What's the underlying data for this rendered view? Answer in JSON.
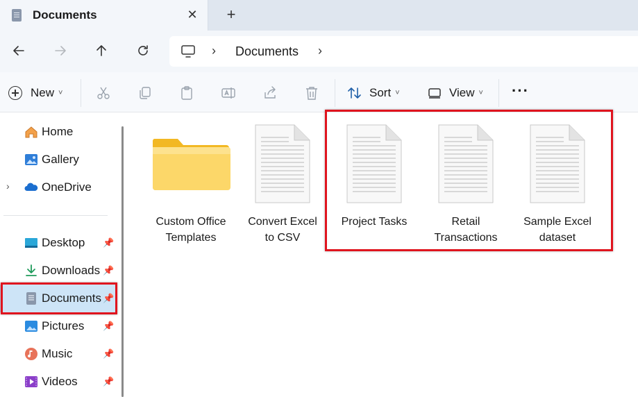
{
  "tab": {
    "title": "Documents",
    "close": "✕",
    "new": "+"
  },
  "address": {
    "path": "Documents",
    "sep": "›"
  },
  "toolbar": {
    "new_label": "New",
    "sort_label": "Sort",
    "view_label": "View",
    "more_label": "···",
    "caret": "˅"
  },
  "sidebar": {
    "items": [
      {
        "label": "Home",
        "icon": "home-icon"
      },
      {
        "label": "Gallery",
        "icon": "gallery-icon"
      },
      {
        "label": "OneDrive",
        "icon": "onedrive-icon",
        "expander": "›"
      },
      {
        "label": "Desktop",
        "icon": "desktop-icon",
        "pin": "📌"
      },
      {
        "label": "Downloads",
        "icon": "downloads-icon",
        "pin": "📌"
      },
      {
        "label": "Documents",
        "icon": "documents-icon",
        "pin": "📌",
        "active": true
      },
      {
        "label": "Pictures",
        "icon": "pictures-icon",
        "pin": "📌"
      },
      {
        "label": "Music",
        "icon": "music-icon",
        "pin": "📌"
      },
      {
        "label": "Videos",
        "icon": "videos-icon",
        "pin": "📌"
      }
    ]
  },
  "files": [
    {
      "line1": "Custom Office",
      "line2": "Templates",
      "type": "folder"
    },
    {
      "line1": "Convert Excel",
      "line2": "to CSV",
      "type": "document"
    },
    {
      "line1": "Project Tasks",
      "line2": "",
      "type": "document"
    },
    {
      "line1": "Retail",
      "line2": "Transactions",
      "type": "document"
    },
    {
      "line1": "Sample Excel",
      "line2": "dataset",
      "type": "document"
    }
  ],
  "colors": {
    "highlight": "#e0141e",
    "active_bg": "#cde4f7",
    "folder": "#f6c445"
  }
}
